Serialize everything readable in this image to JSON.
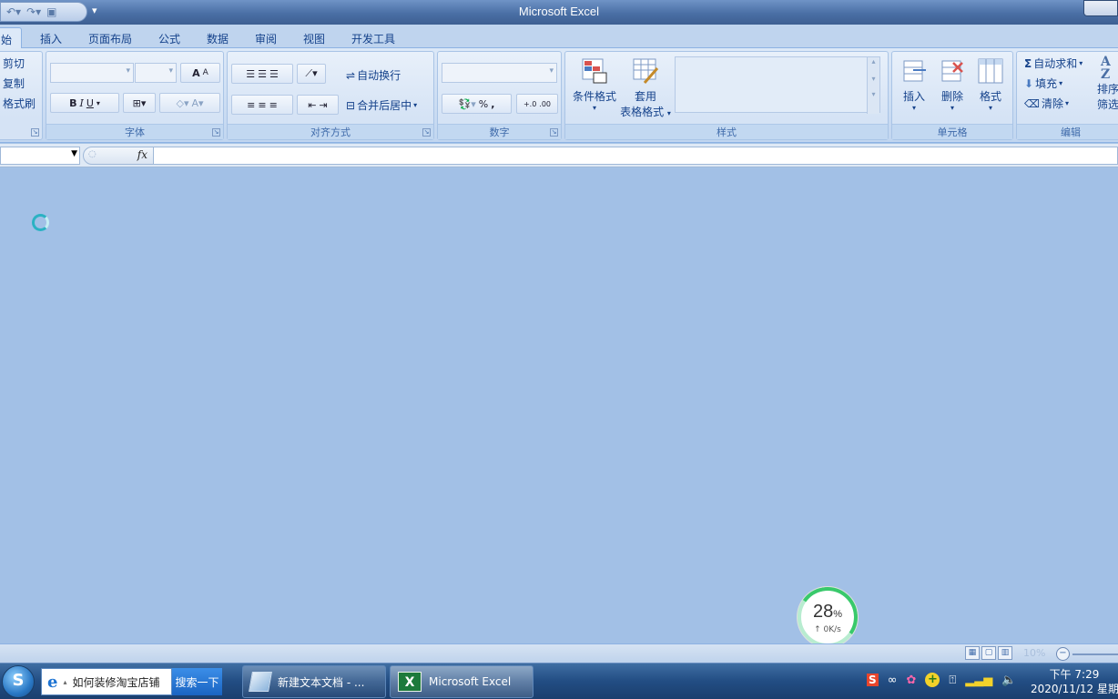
{
  "window": {
    "title": "Microsoft Excel"
  },
  "tabs": [
    "开始",
    "插入",
    "页面布局",
    "公式",
    "数据",
    "审阅",
    "视图",
    "开发工具"
  ],
  "tab_display": [
    "始",
    "插入",
    "页面布局",
    "公式",
    "数据",
    "审阅",
    "视图",
    "开发工具"
  ],
  "clipboard": {
    "cut": "剪切",
    "copy": "复制",
    "format_painter": "格式刷"
  },
  "font": {
    "label": "字体",
    "grow": "A",
    "shrink": "A",
    "bold": "B",
    "italic": "I",
    "underline": "U"
  },
  "alignment": {
    "label": "对齐方式",
    "wrap_text": "自动换行",
    "merge_center": "合并后居中"
  },
  "number": {
    "label": "数字",
    "percent": "%",
    "comma": ",",
    "inc_decimal": "+.0",
    "dec_decimal": ".00"
  },
  "styles": {
    "label": "样式",
    "conditional_format": "条件格式",
    "format_table_1": "套用",
    "format_table_2": "表格格式"
  },
  "cells": {
    "label": "单元格",
    "insert": "插入",
    "delete": "删除",
    "format": "格式"
  },
  "editing": {
    "label": "编辑",
    "autosum": "自动求和",
    "fill": "填充",
    "clear": "清除",
    "sort_1": "排序",
    "sort_2": "筛选",
    "sigma": "Σ"
  },
  "formula_bar": {
    "fx": "fx",
    "name_value": "",
    "formula_value": ""
  },
  "status": {
    "zoom": "10%"
  },
  "speed_widget": {
    "percent": "28",
    "percent_unit": "%",
    "rate": "↑ 0K/s"
  },
  "taskbar": {
    "search_text": "如何装修淘宝店铺",
    "search_button": "搜索一下",
    "tasks": [
      "新建文本文档 - ...",
      "Microsoft Excel"
    ],
    "clock_time": "下午 7:29",
    "clock_date": "2020/11/12 星期"
  },
  "colors": {
    "workspace": "#a2c0e6",
    "ribbon": "#dce8f7",
    "accent": "#15428b",
    "taskbar": "#224d83"
  }
}
